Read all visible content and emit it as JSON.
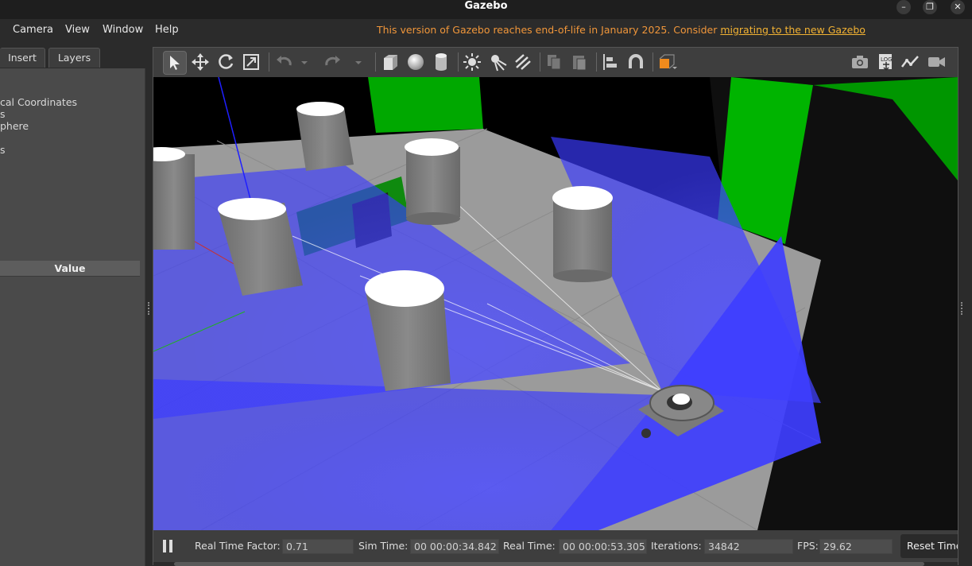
{
  "window": {
    "title": "Gazebo",
    "controls": [
      "minimize-icon",
      "restore-icon",
      "close-icon"
    ]
  },
  "menubar": {
    "items": [
      "Camera",
      "View",
      "Window",
      "Help"
    ],
    "notice_text": "This version of Gazebo reaches end-of-life in January 2025. Consider ",
    "notice_link": "migrating to the new Gazebo"
  },
  "left_panel": {
    "tabs": [
      "Insert",
      "Layers"
    ],
    "tree_items": [
      "cal Coordinates",
      "s",
      "phere",
      "s"
    ],
    "value_header": "Value"
  },
  "toolbar": {
    "tools": [
      "select-arrow-icon",
      "translate-icon",
      "rotate-icon",
      "scale-icon",
      "undo-icon",
      "undo-dropdown-icon",
      "redo-icon",
      "redo-dropdown-icon",
      "box-icon",
      "sphere-icon",
      "cylinder-icon",
      "sun-light-icon",
      "spot-light-icon",
      "directional-light-icon",
      "copy-icon",
      "paste-icon",
      "align-icon",
      "magnet-snap-icon",
      "view-angle-icon",
      "screenshot-icon",
      "log-icon",
      "plot-icon",
      "video-record-icon"
    ]
  },
  "status": {
    "real_time_factor_label": "Real Time Factor:",
    "real_time_factor": "0.71",
    "sim_time_label": "Sim Time:",
    "sim_time": "00 00:00:34.842",
    "real_time_label": "Real Time:",
    "real_time": "00 00:00:53.305",
    "iterations_label": "Iterations:",
    "iterations": "34842",
    "fps_label": "FPS:",
    "fps": "29.62",
    "reset_button": "Reset Time"
  },
  "colors": {
    "notice": "#f0963a",
    "link": "#f2b233",
    "laser": "#3a3aff",
    "wall": "#00b400",
    "ground": "#9a9a9a"
  }
}
